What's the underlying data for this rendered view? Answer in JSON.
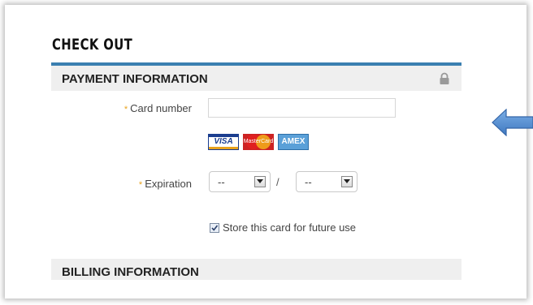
{
  "checkout": {
    "title": "CHECK OUT"
  },
  "payment": {
    "header": "PAYMENT INFORMATION",
    "card_number": {
      "required_mark": "*",
      "label": "Card number",
      "value": "",
      "placeholder": ""
    },
    "card_logos": {
      "visa": "VISA",
      "mastercard": "MasterCard",
      "amex": "AMEX"
    },
    "expiration": {
      "required_mark": "*",
      "label": "Expiration",
      "month": "--",
      "separator": "/",
      "year": "--"
    },
    "store_card": {
      "label": "Store this card for future use",
      "checked": true
    }
  },
  "billing": {
    "header": "BILLING INFORMATION"
  },
  "colors": {
    "accent_rule": "#3a7fb0",
    "arrow": "#5b8fd0",
    "required": "#e8a21d"
  }
}
